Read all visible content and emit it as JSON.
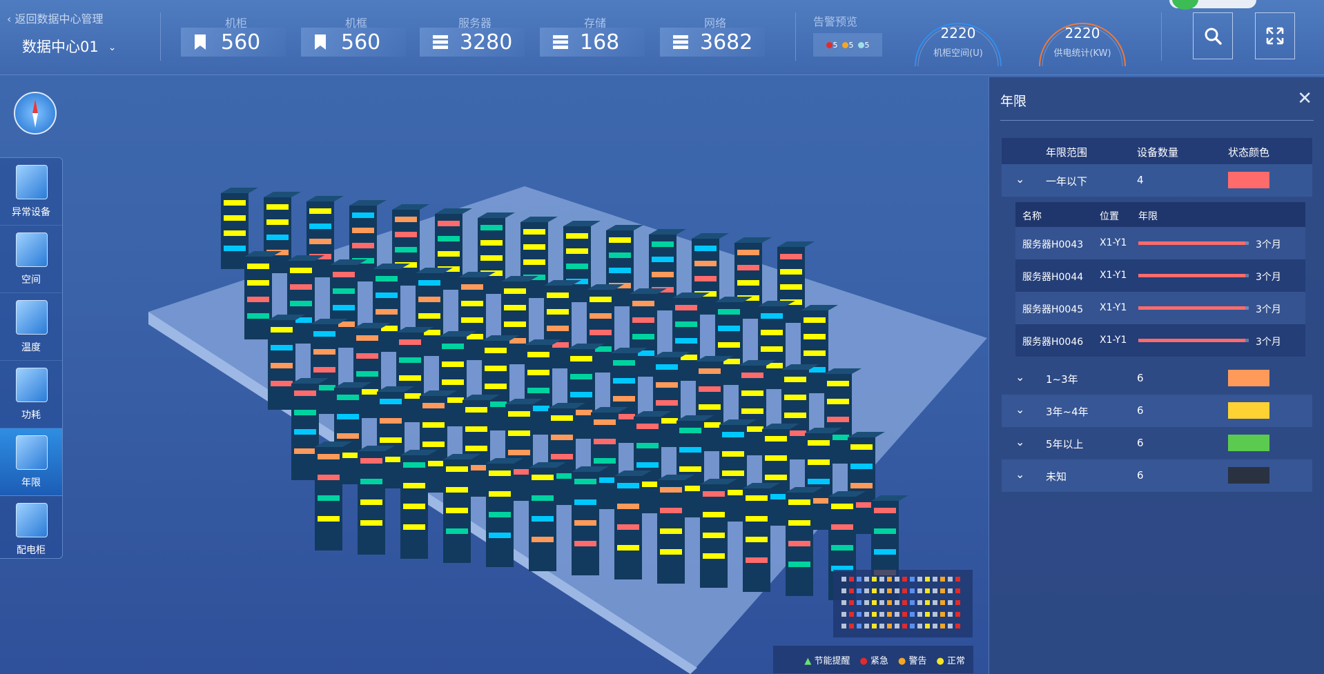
{
  "header": {
    "back_label": "返回数据中心管理",
    "datacenter": "数据中心01",
    "stats": [
      {
        "label": "机柜",
        "value": "560",
        "icon": "bookmark-icon"
      },
      {
        "label": "机框",
        "value": "560",
        "icon": "bookmark-icon"
      },
      {
        "label": "服务器",
        "value": "3280",
        "icon": "server-icon"
      },
      {
        "label": "存储",
        "value": "168",
        "icon": "storage-icon"
      },
      {
        "label": "网络",
        "value": "3682",
        "icon": "network-icon"
      }
    ],
    "alarm": {
      "label": "告警预览",
      "counts": [
        {
          "value": "5",
          "color": "#e52a2a"
        },
        {
          "value": "5",
          "color": "#f5a623"
        },
        {
          "value": "5",
          "color": "#9fe0e8"
        }
      ]
    },
    "gauges": [
      {
        "value": "2220",
        "label": "机柜空间(U)",
        "color": "#2f8ff0"
      },
      {
        "value": "2220",
        "label": "供电统计(KW)",
        "color": "#f07a3a"
      }
    ]
  },
  "nav": {
    "items": [
      {
        "label": "异常设备"
      },
      {
        "label": "空间"
      },
      {
        "label": "温度"
      },
      {
        "label": "功耗"
      },
      {
        "label": "年限",
        "active": true
      },
      {
        "label": "配电柜"
      }
    ]
  },
  "panel": {
    "title": "年限",
    "columns": [
      "年限范围",
      "设备数量",
      "状态颜色"
    ],
    "groups": [
      {
        "range": "一年以下",
        "count": "4",
        "color": "#ff6b6b",
        "expanded": true
      },
      {
        "range": "1~3年",
        "count": "6",
        "color": "#ff9a5a"
      },
      {
        "range": "3年~4年",
        "count": "6",
        "color": "#ffd234"
      },
      {
        "range": "5年以上",
        "count": "6",
        "color": "#5bcb4f"
      },
      {
        "range": "未知",
        "count": "6",
        "color": "#2a3242"
      }
    ],
    "sub_columns": [
      "名称",
      "位置",
      "年限"
    ],
    "sub_rows": [
      {
        "name": "服务器H0043",
        "pos": "X1-Y1",
        "age": "3个月",
        "fill": 0.97
      },
      {
        "name": "服务器H0044",
        "pos": "X1-Y1",
        "age": "3个月",
        "fill": 0.97
      },
      {
        "name": "服务器H0045",
        "pos": "X1-Y1",
        "age": "3个月",
        "fill": 0.97
      },
      {
        "name": "服务器H0046",
        "pos": "X1-Y1",
        "age": "3个月",
        "fill": 0.97
      }
    ]
  },
  "legend": [
    {
      "label": "节能提醒",
      "color": "#6ee06e",
      "icon": "warning-triangle-icon"
    },
    {
      "label": "紧急",
      "color": "#e52a2a",
      "icon": "map-pin-icon"
    },
    {
      "label": "警告",
      "color": "#f5a623",
      "icon": "map-pin-icon"
    },
    {
      "label": "正常",
      "color": "#f5e623",
      "icon": "map-pin-icon"
    }
  ]
}
